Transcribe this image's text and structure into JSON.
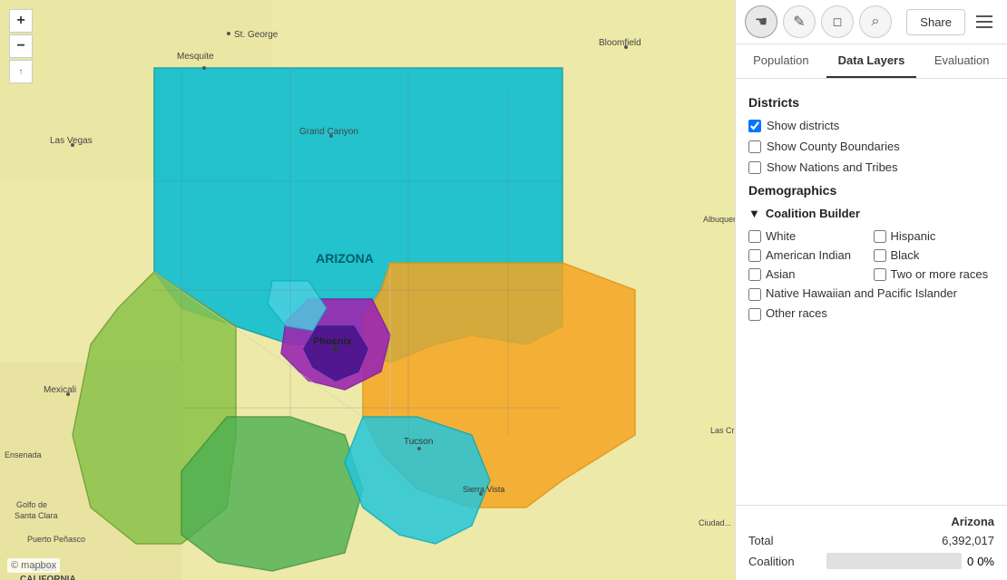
{
  "toolbar": {
    "tools": [
      {
        "id": "hand",
        "icon": "✋",
        "label": "Pan tool",
        "active": true
      },
      {
        "id": "pencil",
        "icon": "✏️",
        "label": "Draw tool",
        "active": false
      },
      {
        "id": "eraser",
        "icon": "◻",
        "label": "Erase tool",
        "active": false
      },
      {
        "id": "search",
        "icon": "🔍",
        "label": "Search tool",
        "active": false
      }
    ],
    "share_label": "Share",
    "menu_label": "Menu"
  },
  "tabs": [
    {
      "id": "population",
      "label": "Population",
      "active": false
    },
    {
      "id": "data-layers",
      "label": "Data Layers",
      "active": true
    },
    {
      "id": "evaluation",
      "label": "Evaluation",
      "active": false
    }
  ],
  "districts_section": {
    "header": "Districts",
    "show_districts": {
      "label": "Show districts",
      "checked": true
    },
    "show_county": {
      "label": "Show County Boundaries",
      "checked": false
    },
    "show_nations": {
      "label": "Show Nations and Tribes",
      "checked": false
    }
  },
  "demographics_section": {
    "header": "Demographics",
    "coalition_builder": {
      "label": "Coalition Builder",
      "arrow": "▼",
      "races": [
        {
          "id": "white",
          "label": "White",
          "checked": false
        },
        {
          "id": "hispanic",
          "label": "Hispanic",
          "checked": false
        },
        {
          "id": "american-indian",
          "label": "American Indian",
          "checked": false
        },
        {
          "id": "black",
          "label": "Black",
          "checked": false
        },
        {
          "id": "asian",
          "label": "Asian",
          "checked": false
        },
        {
          "id": "two-or-more",
          "label": "Two or more races",
          "checked": false
        }
      ],
      "full_row_races": [
        {
          "id": "native-hawaiian",
          "label": "Native Hawaiian and Pacific Islander",
          "checked": false
        },
        {
          "id": "other",
          "label": "Other races",
          "checked": false
        }
      ]
    }
  },
  "stats": {
    "region_label": "Arizona",
    "total_label": "Total",
    "total_value": "6,392,017",
    "coalition_label": "Coalition",
    "coalition_value": "0",
    "coalition_pct": "0%",
    "coalition_bar_pct": 0
  },
  "map": {
    "city_labels": [
      "St. George",
      "Bloomfield",
      "Las Vegas",
      "Grand Canyon",
      "ARIZONA",
      "Phoenix",
      "Mexicali",
      "Albuquer...",
      "Las Cruce...",
      "Tucson",
      "Sierra Vista",
      "Ensenada",
      "Golfo de Santa Clara",
      "Puerto Peñasco",
      "Ciudad..."
    ],
    "copyright": "© mapbox",
    "region": "BAJA CALIFORNIA"
  }
}
